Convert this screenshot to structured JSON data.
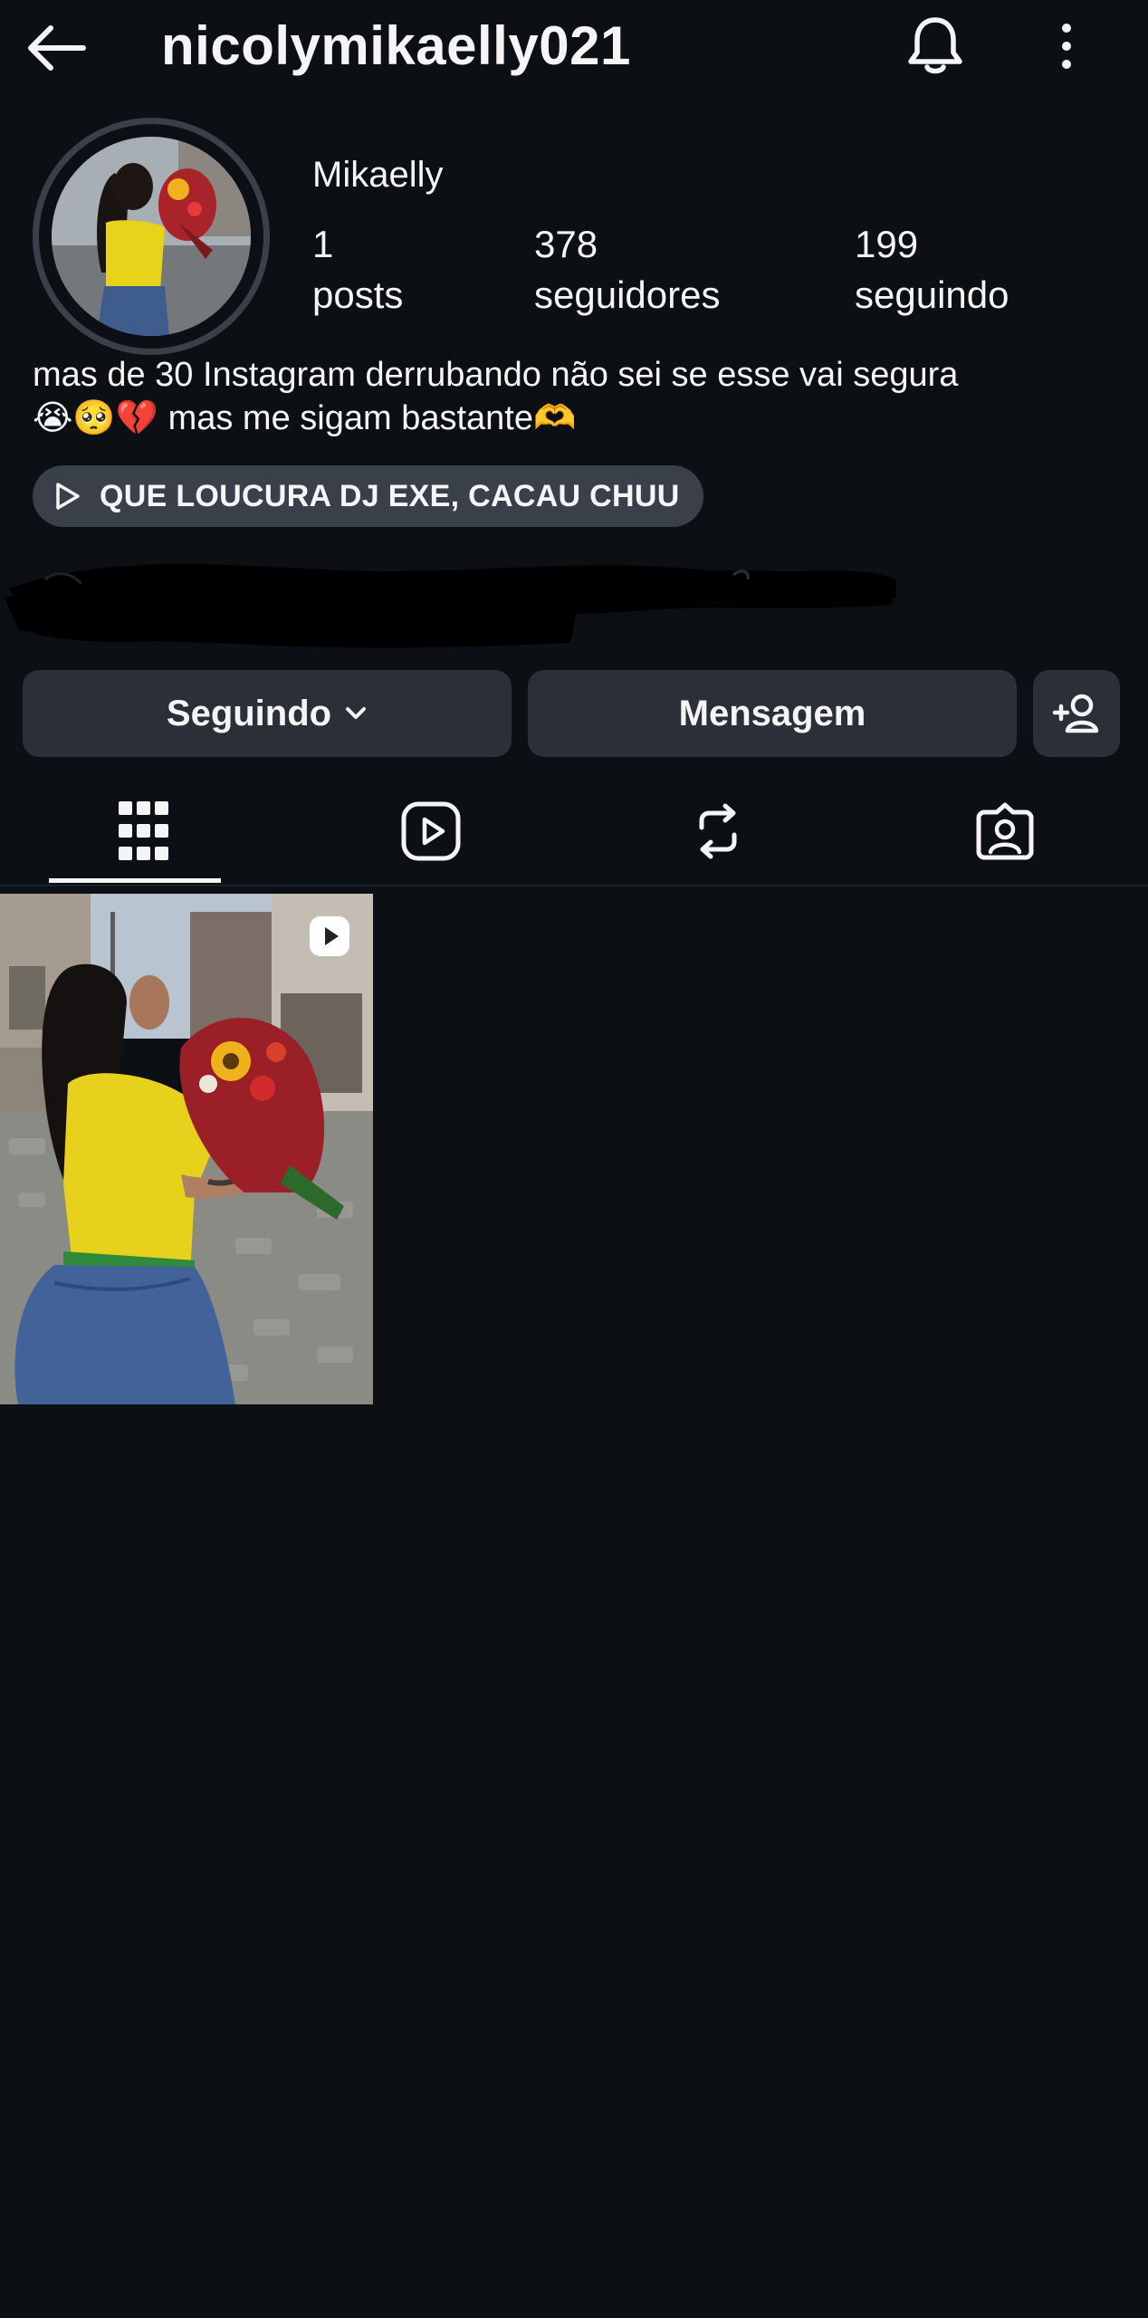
{
  "header": {
    "username": "nicolymikaelly021"
  },
  "profile": {
    "display_name": "Mikaelly",
    "stats": [
      {
        "value": "1",
        "label": "posts"
      },
      {
        "value": "378",
        "label": "seguidores"
      },
      {
        "value": "199",
        "label": "seguindo"
      }
    ],
    "bio_line1": "mas de 30 Instagram derrubando não sei se esse vai segura",
    "bio_line2": "😭🥺💔 mas me sigam bastante🫶",
    "music": "QUE LOUCURA DJ EXE, CACAU CHUU"
  },
  "actions": {
    "following_label": "Seguindo",
    "message_label": "Mensagem"
  },
  "tabs": [
    {
      "icon": "grid-icon",
      "active": true
    },
    {
      "icon": "reels-icon",
      "active": false
    },
    {
      "icon": "reposts-icon",
      "active": false
    },
    {
      "icon": "tagged-icon",
      "active": false
    }
  ],
  "colors": {
    "background": "#0c0f14",
    "button": "#2b3038",
    "pill": "#3a404a",
    "text": "#f5f5f5"
  }
}
